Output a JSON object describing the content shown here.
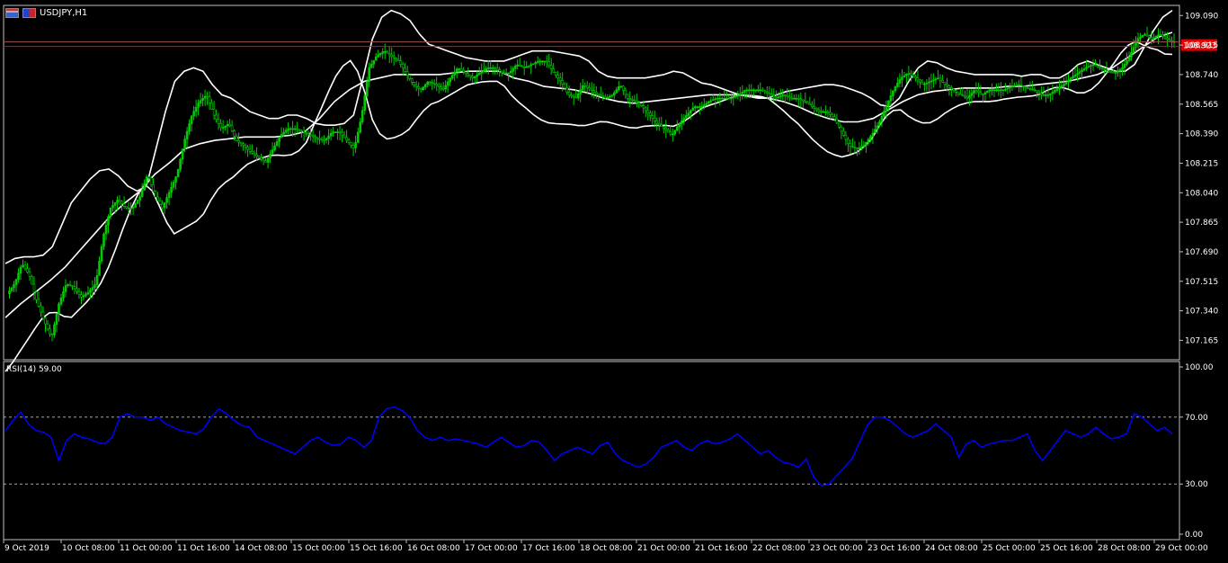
{
  "window": {
    "symbol_title": "USDJPY,H1",
    "flag_icons": [
      "chart-window-icon",
      "us-jp-flag-icon"
    ]
  },
  "colors": {
    "background": "#000000",
    "candle_up": "#00cc00",
    "candle_down": "#00cc00",
    "bands": "#ffffff",
    "rsi_line": "#0000ff",
    "price_line": "#ff0000",
    "grid_dashed": "#c0c0c0",
    "frame": "#c0c0c0"
  },
  "chart_data": [
    {
      "type": "candlestick",
      "name": "price",
      "title": "USDJPY,H1",
      "current_price_label": "108.923",
      "ylim": [
        107.05,
        109.15
      ],
      "y_ticks": [
        109.09,
        108.915,
        108.74,
        108.565,
        108.39,
        108.215,
        108.04,
        107.865,
        107.69,
        107.515,
        107.34,
        107.165
      ],
      "y_tick_labels": [
        "109.090",
        "108.915",
        "108.740",
        "108.565",
        "108.390",
        "108.215",
        "108.040",
        "107.865",
        "107.690",
        "107.515",
        "107.340",
        "107.165"
      ],
      "x_tick_labels": [
        "9 Oct 2019",
        "10 Oct 08:00",
        "11 Oct 00:00",
        "11 Oct 16:00",
        "14 Oct 08:00",
        "15 Oct 00:00",
        "15 Oct 16:00",
        "16 Oct 08:00",
        "17 Oct 00:00",
        "17 Oct 16:00",
        "18 Oct 08:00",
        "21 Oct 00:00",
        "21 Oct 16:00",
        "22 Oct 08:00",
        "23 Oct 00:00",
        "23 Oct 16:00",
        "24 Oct 08:00",
        "25 Oct 00:00",
        "25 Oct 16:00",
        "28 Oct 08:00",
        "29 Oct 00:00"
      ],
      "close_path": [
        107.44,
        107.5,
        107.62,
        107.55,
        107.4,
        107.28,
        107.18,
        107.38,
        107.5,
        107.48,
        107.42,
        107.45,
        107.5,
        107.78,
        107.95,
        108.0,
        107.95,
        107.95,
        108.02,
        108.15,
        108.02,
        107.95,
        108.05,
        108.15,
        108.35,
        108.5,
        108.58,
        108.62,
        108.5,
        108.42,
        108.45,
        108.35,
        108.32,
        108.28,
        108.25,
        108.22,
        108.3,
        108.38,
        108.42,
        108.42,
        108.4,
        108.38,
        108.36,
        108.35,
        108.4,
        108.4,
        108.35,
        108.3,
        108.5,
        108.78,
        108.85,
        108.88,
        108.85,
        108.82,
        108.75,
        108.68,
        108.65,
        108.7,
        108.68,
        108.65,
        108.72,
        108.78,
        108.75,
        108.72,
        108.75,
        108.78,
        108.78,
        108.75,
        108.75,
        108.8,
        108.78,
        108.8,
        108.82,
        108.82,
        108.75,
        108.7,
        108.62,
        108.6,
        108.68,
        108.65,
        108.62,
        108.6,
        108.62,
        108.68,
        108.6,
        108.58,
        108.55,
        108.5,
        108.45,
        108.42,
        108.38,
        108.45,
        108.5,
        108.55,
        108.55,
        108.58,
        108.6,
        108.6,
        108.6,
        108.62,
        108.65,
        108.65,
        108.65,
        108.63,
        108.6,
        108.62,
        108.6,
        108.6,
        108.58,
        108.55,
        108.52,
        108.52,
        108.48,
        108.4,
        108.32,
        108.3,
        108.32,
        108.38,
        108.45,
        108.55,
        108.65,
        108.72,
        108.75,
        108.72,
        108.68,
        108.7,
        108.72,
        108.68,
        108.65,
        108.62,
        108.6,
        108.65,
        108.62,
        108.65,
        108.65,
        108.65,
        108.67,
        108.68,
        108.66,
        108.65,
        108.62,
        108.62,
        108.65,
        108.68,
        108.72,
        108.75,
        108.78,
        108.8,
        108.78,
        108.76,
        108.75,
        108.78,
        108.85,
        108.95,
        108.98,
        108.95,
        108.98,
        108.95,
        108.93
      ],
      "upper_band": [
        107.62,
        107.65,
        107.66,
        107.66,
        107.67,
        107.72,
        107.85,
        107.98,
        108.05,
        108.12,
        108.17,
        108.18,
        108.14,
        108.08,
        108.05,
        108.08,
        108.3,
        108.52,
        108.7,
        108.76,
        108.78,
        108.76,
        108.68,
        108.62,
        108.6,
        108.56,
        108.52,
        108.5,
        108.48,
        108.48,
        108.5,
        108.5,
        108.48,
        108.45,
        108.44,
        108.44,
        108.45,
        108.5,
        108.72,
        108.95,
        109.08,
        109.12,
        109.1,
        109.06,
        108.98,
        108.92,
        108.9,
        108.88,
        108.86,
        108.84,
        108.83,
        108.82,
        108.82,
        108.82,
        108.84,
        108.86,
        108.88,
        108.88,
        108.88,
        108.87,
        108.86,
        108.85,
        108.82,
        108.76,
        108.73,
        108.72,
        108.72,
        108.72,
        108.72,
        108.73,
        108.74,
        108.76,
        108.75,
        108.72,
        108.69,
        108.68,
        108.66,
        108.64,
        108.62,
        108.61,
        108.6,
        108.6,
        108.62,
        108.64,
        108.65,
        108.66,
        108.67,
        108.68,
        108.68,
        108.67,
        108.65,
        108.63,
        108.6,
        108.56,
        108.55,
        108.6,
        108.7,
        108.78,
        108.82,
        108.81,
        108.78,
        108.76,
        108.75,
        108.74,
        108.74,
        108.74,
        108.74,
        108.74,
        108.73,
        108.74,
        108.74,
        108.72,
        108.72,
        108.75,
        108.8,
        108.82,
        108.8,
        108.78,
        108.76,
        108.76,
        108.8,
        108.9,
        109.0,
        109.08,
        109.12
      ],
      "middle_band": [
        107.3,
        107.38,
        107.45,
        107.52,
        107.6,
        107.7,
        107.8,
        107.9,
        107.98,
        108.05,
        108.15,
        108.22,
        108.3,
        108.33,
        108.35,
        108.36,
        108.37,
        108.37,
        108.37,
        108.38,
        108.4,
        108.48,
        108.58,
        108.65,
        108.7,
        108.72,
        108.74,
        108.74,
        108.74,
        108.74,
        108.75,
        108.76,
        108.76,
        108.76,
        108.72,
        108.7,
        108.67,
        108.66,
        108.65,
        108.63,
        108.6,
        108.58,
        108.57,
        108.58,
        108.59,
        108.6,
        108.61,
        108.62,
        108.62,
        108.62,
        108.61,
        108.6,
        108.58,
        108.55,
        108.51,
        108.48,
        108.46,
        108.46,
        108.48,
        108.53,
        108.58,
        108.62,
        108.64,
        108.65,
        108.66,
        108.66,
        108.66,
        108.67,
        108.67,
        108.68,
        108.69,
        108.7,
        108.72,
        108.74,
        108.78,
        108.84,
        108.9,
        108.96,
        108.99
      ]
    },
    {
      "type": "line",
      "name": "RSI(14)",
      "label": "RSI(14) 59.00",
      "ylim": [
        0,
        100
      ],
      "y_tick_labels": [
        "100.00",
        "70.00",
        "30.00",
        "0.00"
      ],
      "y_ticks": [
        100,
        70,
        30,
        0
      ],
      "levels": [
        70,
        30
      ],
      "values": [
        62,
        68,
        73,
        66,
        62,
        61,
        58,
        44,
        56,
        60,
        58,
        57,
        55,
        54,
        58,
        70,
        72,
        70,
        70,
        68,
        70,
        66,
        64,
        62,
        61,
        60,
        63,
        70,
        75,
        72,
        68,
        65,
        64,
        58,
        56,
        54,
        52,
        50,
        48,
        52,
        56,
        58,
        55,
        53,
        54,
        58,
        56,
        52,
        56,
        70,
        75,
        76,
        74,
        70,
        62,
        58,
        56,
        58,
        56,
        57,
        56,
        55,
        54,
        52,
        55,
        58,
        55,
        52,
        53,
        56,
        55,
        50,
        44,
        48,
        50,
        52,
        50,
        48,
        53,
        55,
        48,
        44,
        42,
        40,
        42,
        46,
        52,
        54,
        56,
        52,
        50,
        54,
        56,
        54,
        55,
        57,
        60,
        56,
        52,
        48,
        50,
        46,
        43,
        42,
        40,
        45,
        34,
        29,
        30,
        35,
        40,
        45,
        55,
        65,
        70,
        70,
        68,
        64,
        60,
        58,
        60,
        62,
        66,
        62,
        58,
        46,
        54,
        56,
        52,
        54,
        55,
        56,
        56,
        58,
        60,
        50,
        44,
        50,
        56,
        62,
        60,
        58,
        60,
        64,
        60,
        57,
        58,
        60,
        72,
        70,
        66,
        62,
        64,
        60
      ]
    }
  ]
}
